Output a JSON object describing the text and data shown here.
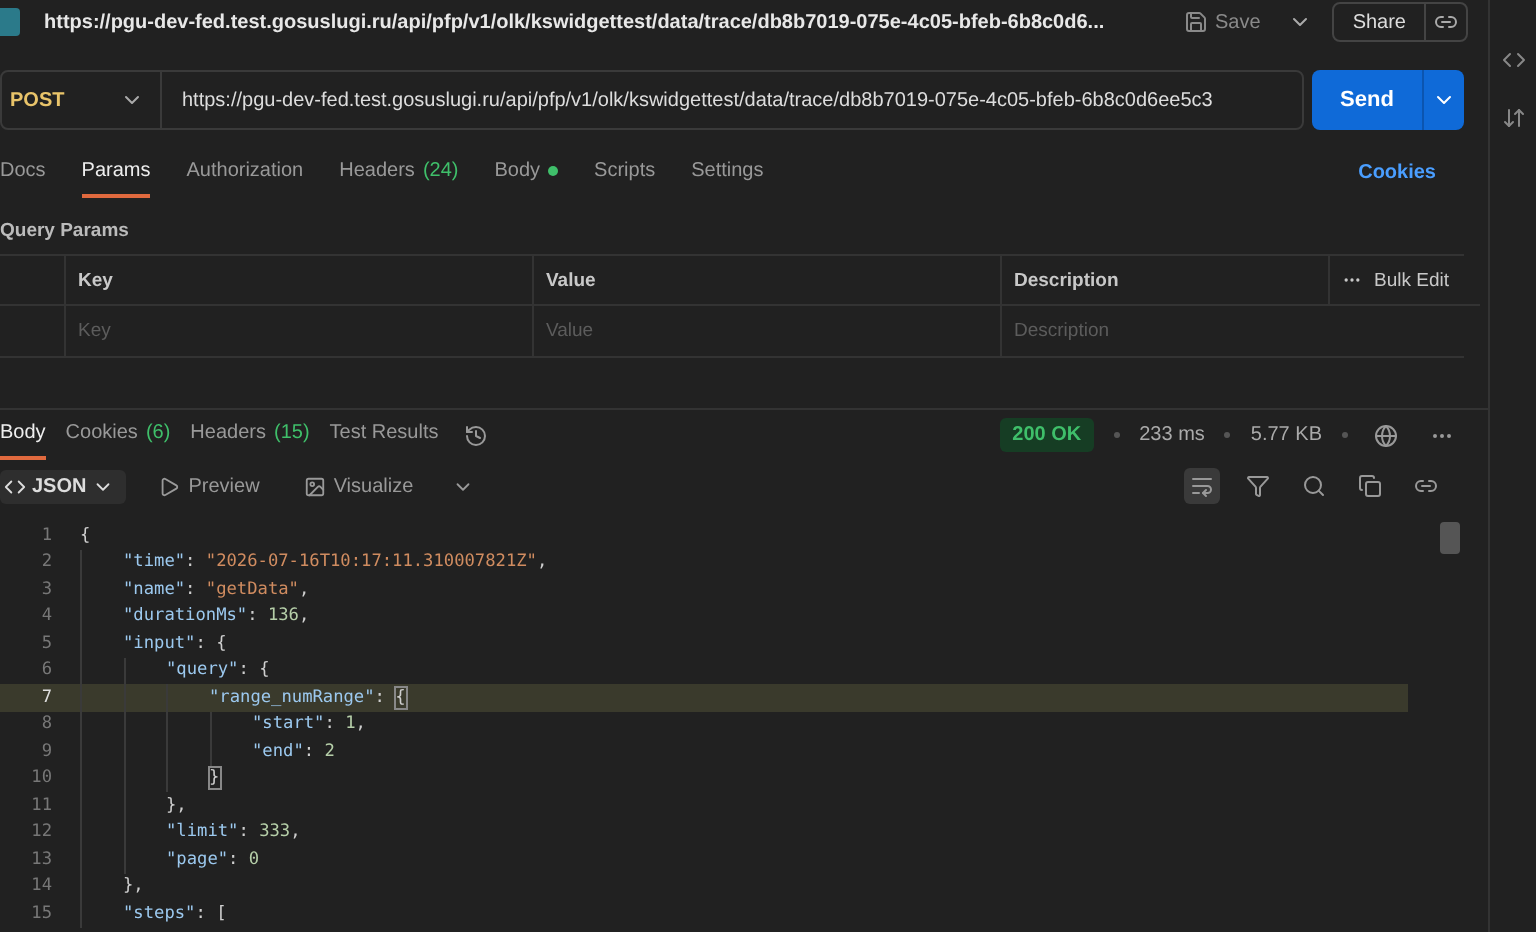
{
  "header": {
    "title": "https://pgu-dev-fed.test.gosuslugi.ru/api/pfp/v1/olk/kswidgettest/data/trace/db8b7019-075e-4c05-bfeb-6b8c0d6...",
    "save": "Save",
    "share": "Share"
  },
  "request": {
    "method": "POST",
    "url": "https://pgu-dev-fed.test.gosuslugi.ru/api/pfp/v1/olk/kswidgettest/data/trace/db8b7019-075e-4c05-bfeb-6b8c0d6ee5c3",
    "send": "Send"
  },
  "request_tabs": [
    {
      "label": "Docs",
      "selected": false
    },
    {
      "label": "Params",
      "selected": true
    },
    {
      "label": "Authorization",
      "selected": false
    },
    {
      "label": "Headers",
      "count": "(24)",
      "selected": false
    },
    {
      "label": "Body",
      "has_content": true,
      "selected": false
    },
    {
      "label": "Scripts",
      "selected": false
    },
    {
      "label": "Settings",
      "selected": false
    }
  ],
  "cookies_link": "Cookies",
  "query_params": {
    "title": "Query Params",
    "columns": [
      "Key",
      "Value",
      "Description"
    ],
    "bulk_edit": "Bulk Edit",
    "placeholders": [
      "Key",
      "Value",
      "Description"
    ]
  },
  "response_tabs": [
    {
      "label": "Body",
      "selected": true
    },
    {
      "label": "Cookies",
      "count": "(6)",
      "selected": false
    },
    {
      "label": "Headers",
      "count": "(15)",
      "selected": false
    },
    {
      "label": "Test Results",
      "selected": false
    }
  ],
  "status": {
    "code": "200 OK",
    "time": "233 ms",
    "size": "5.77 KB"
  },
  "viewer": {
    "format": "JSON",
    "preview": "Preview",
    "visualize": "Visualize",
    "wrap_on": true
  },
  "code": {
    "lines": [
      {
        "number": "1",
        "highlighted": false,
        "tokens": [
          {
            "kind": "punct",
            "text": "{"
          }
        ]
      },
      {
        "number": "2",
        "highlighted": false,
        "tokens": [
          {
            "kind": "key",
            "text": "\"time\""
          },
          {
            "kind": "punct",
            "text": ": "
          },
          {
            "kind": "str",
            "text": "\"2026-07-16T10:17:11.310007821Z\""
          },
          {
            "kind": "punct",
            "text": ","
          }
        ]
      },
      {
        "number": "3",
        "highlighted": false,
        "tokens": [
          {
            "kind": "key",
            "text": "\"name\""
          },
          {
            "kind": "punct",
            "text": ": "
          },
          {
            "kind": "str",
            "text": "\"getData\""
          },
          {
            "kind": "punct",
            "text": ","
          }
        ]
      },
      {
        "number": "4",
        "highlighted": false,
        "tokens": [
          {
            "kind": "key",
            "text": "\"durationMs\""
          },
          {
            "kind": "punct",
            "text": ": "
          },
          {
            "kind": "num",
            "text": "136"
          },
          {
            "kind": "punct",
            "text": ","
          }
        ]
      },
      {
        "number": "5",
        "highlighted": false,
        "tokens": [
          {
            "kind": "key",
            "text": "\"input\""
          },
          {
            "kind": "punct",
            "text": ": {"
          }
        ]
      },
      {
        "number": "6",
        "highlighted": false,
        "tokens": [
          {
            "kind": "key",
            "text": "\"query\""
          },
          {
            "kind": "punct",
            "text": ": {"
          }
        ]
      },
      {
        "number": "7",
        "highlighted": true,
        "tokens": [
          {
            "kind": "key",
            "text": "\"range_numRange\""
          },
          {
            "kind": "punct",
            "text": ": "
          },
          {
            "kind": "punct",
            "text": "{",
            "matched": true
          }
        ]
      },
      {
        "number": "8",
        "highlighted": false,
        "tokens": [
          {
            "kind": "key",
            "text": "\"start\""
          },
          {
            "kind": "punct",
            "text": ": "
          },
          {
            "kind": "num",
            "text": "1"
          },
          {
            "kind": "punct",
            "text": ","
          }
        ]
      },
      {
        "number": "9",
        "highlighted": false,
        "tokens": [
          {
            "kind": "key",
            "text": "\"end\""
          },
          {
            "kind": "punct",
            "text": ": "
          },
          {
            "kind": "num",
            "text": "2"
          }
        ]
      },
      {
        "number": "10",
        "highlighted": false,
        "tokens": [
          {
            "kind": "punct",
            "text": "}",
            "matched": true
          }
        ]
      },
      {
        "number": "11",
        "highlighted": false,
        "tokens": [
          {
            "kind": "punct",
            "text": "},"
          }
        ]
      },
      {
        "number": "12",
        "highlighted": false,
        "tokens": [
          {
            "kind": "key",
            "text": "\"limit\""
          },
          {
            "kind": "punct",
            "text": ": "
          },
          {
            "kind": "num",
            "text": "333"
          },
          {
            "kind": "punct",
            "text": ","
          }
        ]
      },
      {
        "number": "13",
        "highlighted": false,
        "tokens": [
          {
            "kind": "key",
            "text": "\"page\""
          },
          {
            "kind": "punct",
            "text": ": "
          },
          {
            "kind": "num",
            "text": "0"
          }
        ]
      },
      {
        "number": "14",
        "highlighted": false,
        "tokens": [
          {
            "kind": "punct",
            "text": "},"
          }
        ]
      },
      {
        "number": "15",
        "highlighted": false,
        "tokens": [
          {
            "kind": "key",
            "text": "\"steps\""
          },
          {
            "kind": "punct",
            "text": ": ["
          }
        ]
      }
    ]
  }
}
